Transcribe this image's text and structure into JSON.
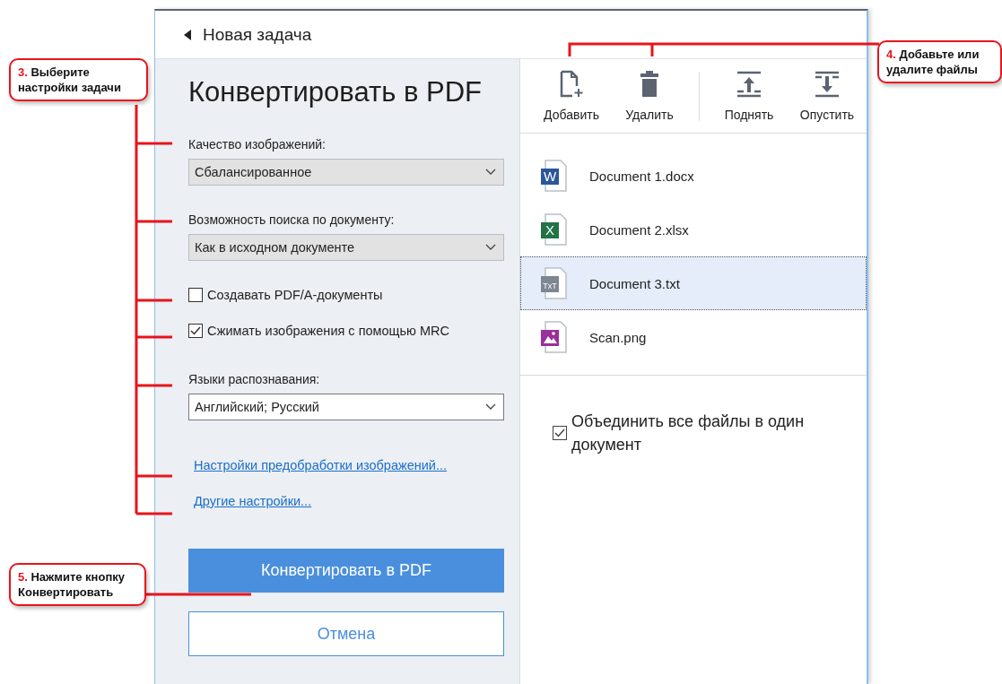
{
  "header": {
    "back_label": "Новая задача"
  },
  "settings": {
    "title": "Конвертировать в PDF",
    "options": [
      {
        "kind": "dropdown",
        "label": "Качество изображений:",
        "value": "Сбалансированное",
        "focused": false
      },
      {
        "kind": "dropdown",
        "label": "Возможность поиска по документу:",
        "value": "Как в исходном документе",
        "focused": false
      },
      {
        "kind": "checkbox",
        "label": "Создавать PDF/A-документы",
        "checked": false
      },
      {
        "kind": "checkbox",
        "label": "Сжимать изображения с помощью MRC",
        "checked": true
      },
      {
        "kind": "dropdown",
        "label": "Языки распознавания:",
        "value": "Английский; Русский",
        "focused": true
      },
      {
        "kind": "link",
        "label": "Настройки предобработки изображений..."
      },
      {
        "kind": "link",
        "label": "Другие настройки..."
      }
    ],
    "convert_button": "Конвертировать в PDF",
    "cancel_button": "Отмена"
  },
  "toolbar": {
    "groups": [
      [
        {
          "kind": "add",
          "label": "Добавить"
        },
        {
          "kind": "delete",
          "label": "Удалить"
        }
      ],
      [
        {
          "kind": "up",
          "label": "Поднять"
        },
        {
          "kind": "down",
          "label": "Опустить"
        }
      ]
    ]
  },
  "files": [
    {
      "kind": "word",
      "badge": "W",
      "name": "Document 1.docx",
      "selected": false
    },
    {
      "kind": "excel",
      "badge": "X",
      "name": "Document 2.xlsx",
      "selected": false
    },
    {
      "kind": "text",
      "badge": "TxT",
      "name": "Document 3.txt",
      "selected": true
    },
    {
      "kind": "image",
      "name": "Scan.png",
      "selected": false
    }
  ],
  "merge": {
    "label": "Объединить все файлы в один документ",
    "checked": true
  },
  "callouts": [
    {
      "number": "3.",
      "text": "Выберите настройки задачи"
    },
    {
      "number": "4.",
      "text": "Добавьте или удалите файлы"
    },
    {
      "number": "5.",
      "text": "Нажмите кнопку Конвертировать"
    }
  ]
}
